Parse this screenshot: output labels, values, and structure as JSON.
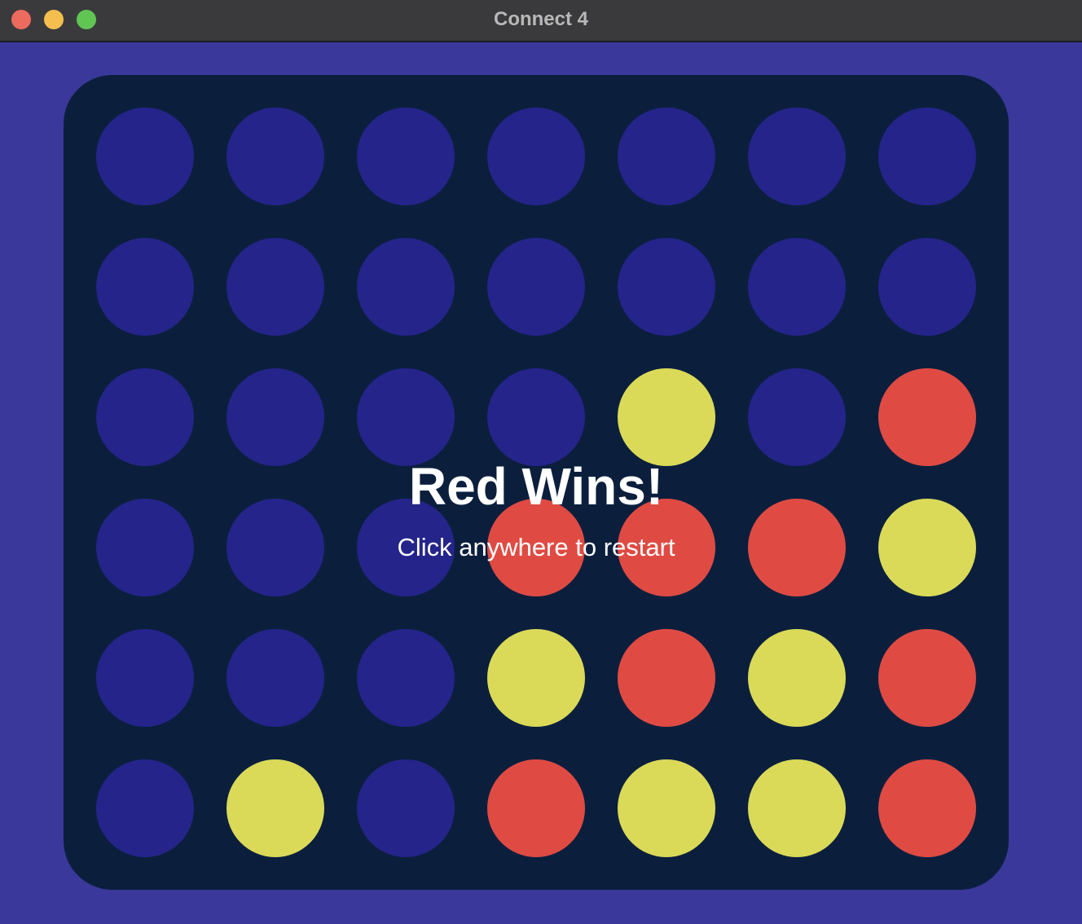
{
  "window": {
    "title": "Connect 4"
  },
  "colors": {
    "background": "#3a389a",
    "board": "#0b1f3d",
    "empty": "#25248a",
    "red": "#df4b43",
    "yellow": "#dada58"
  },
  "board": {
    "rows": 6,
    "columns": 7,
    "cells": [
      [
        "empty",
        "empty",
        "empty",
        "empty",
        "empty",
        "empty",
        "empty"
      ],
      [
        "empty",
        "empty",
        "empty",
        "empty",
        "empty",
        "empty",
        "empty"
      ],
      [
        "empty",
        "empty",
        "empty",
        "empty",
        "yellow",
        "empty",
        "red"
      ],
      [
        "empty",
        "empty",
        "empty",
        "red",
        "red",
        "red",
        "yellow"
      ],
      [
        "empty",
        "empty",
        "empty",
        "yellow",
        "red",
        "yellow",
        "red"
      ],
      [
        "empty",
        "yellow",
        "empty",
        "red",
        "yellow",
        "yellow",
        "red"
      ]
    ]
  },
  "status": {
    "message": "Red Wins!",
    "hint": "Click anywhere to restart"
  }
}
